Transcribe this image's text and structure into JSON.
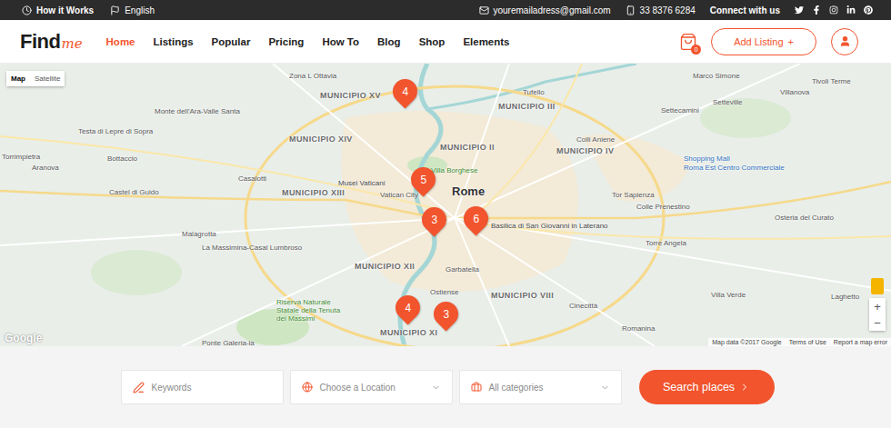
{
  "topbar": {
    "links": [
      {
        "label": "How it Works"
      },
      {
        "label": "English"
      }
    ],
    "email": "youremailadress@gmail.com",
    "phone": "33 8376 6284",
    "social_label": "Connect with us"
  },
  "header": {
    "logo": {
      "main": "Find",
      "accent": "me"
    },
    "nav": [
      {
        "label": "Home",
        "selected": true
      },
      {
        "label": "Listings",
        "selected": false
      },
      {
        "label": "Popular",
        "selected": false
      },
      {
        "label": "Pricing",
        "selected": false
      },
      {
        "label": "How To",
        "selected": false
      },
      {
        "label": "Blog",
        "selected": false
      },
      {
        "label": "Shop",
        "selected": false
      },
      {
        "label": "Elements",
        "selected": false
      }
    ],
    "cart_count": "0",
    "add_listing": "Add Listing",
    "add_icon": "+"
  },
  "map": {
    "types": [
      {
        "label": "Map",
        "selected": true
      },
      {
        "label": "Satellite",
        "selected": false
      }
    ],
    "labels": [
      {
        "text": "Zona L Ottavia",
        "kind": "place"
      },
      {
        "text": "MUNICIPIO XV",
        "kind": "district"
      },
      {
        "text": "Tufello",
        "kind": "place"
      },
      {
        "text": "MUNICIPIO III",
        "kind": "district"
      },
      {
        "text": "Marco Simone",
        "kind": "place"
      },
      {
        "text": "Tivoli Terme",
        "kind": "place"
      },
      {
        "text": "Villanova",
        "kind": "place"
      },
      {
        "text": "Setteville",
        "kind": "place"
      },
      {
        "text": "Settecamini",
        "kind": "place"
      },
      {
        "text": "Monte dell'Ara-Valle Santa",
        "kind": "place"
      },
      {
        "text": "Testa di Lepre di Sopra",
        "kind": "place"
      },
      {
        "text": "Torrimpietra",
        "kind": "place"
      },
      {
        "text": "Bottaccio",
        "kind": "place"
      },
      {
        "text": "Aranova",
        "kind": "place"
      },
      {
        "text": "MUNICIPIO XIV",
        "kind": "district"
      },
      {
        "text": "MUNICIPIO II",
        "kind": "district"
      },
      {
        "text": "MUNICIPIO IV",
        "kind": "district"
      },
      {
        "text": "Colli Aniene",
        "kind": "place"
      },
      {
        "text": "Villa Borghese",
        "kind": "park"
      },
      {
        "text": "Casalotti",
        "kind": "place"
      },
      {
        "text": "Musei Vaticani",
        "kind": "poi"
      },
      {
        "text": "Vatican City",
        "kind": "place"
      },
      {
        "text": "Rome",
        "kind": "city"
      },
      {
        "text": "MUNICIPIO XIII",
        "kind": "district"
      },
      {
        "text": "Castel di Guido",
        "kind": "place"
      },
      {
        "text": "Shopping Mall",
        "kind": "mall"
      },
      {
        "text": "Roma Est Centro Commerciale",
        "kind": "mall"
      },
      {
        "text": "Tor Sapienza",
        "kind": "place"
      },
      {
        "text": "Colle Prenestino",
        "kind": "place"
      },
      {
        "text": "Osteria del Curato",
        "kind": "place"
      },
      {
        "text": "Basilica di San Giovanni in Laterano",
        "kind": "poi"
      },
      {
        "text": "Malagrotta",
        "kind": "place"
      },
      {
        "text": "La Massimina-Casal Lumbroso",
        "kind": "place"
      },
      {
        "text": "Torre Angela",
        "kind": "place"
      },
      {
        "text": "MUNICIPIO XII",
        "kind": "district"
      },
      {
        "text": "Garbatella",
        "kind": "place"
      },
      {
        "text": "Ostiense",
        "kind": "place"
      },
      {
        "text": "MUNICIPIO VIII",
        "kind": "district"
      },
      {
        "text": "Riserva Naturale Statale della Tenuta dei Massimi",
        "kind": "park"
      },
      {
        "text": "Cinecittà",
        "kind": "place"
      },
      {
        "text": "Villa Verde",
        "kind": "place"
      },
      {
        "text": "Laghetto",
        "kind": "place"
      },
      {
        "text": "MUNICIPIO XI",
        "kind": "district"
      },
      {
        "text": "Romanina",
        "kind": "place"
      },
      {
        "text": "Ponte Galeria-la",
        "kind": "place"
      }
    ],
    "pins": [
      {
        "count": "4"
      },
      {
        "count": "5"
      },
      {
        "count": "3"
      },
      {
        "count": "6"
      },
      {
        "count": "4"
      },
      {
        "count": "3"
      }
    ],
    "zoom_in": "+",
    "zoom_out": "−",
    "google": "Google",
    "attribution": [
      "Map data ©2017 Google",
      "Terms of Use",
      "Report a map error"
    ]
  },
  "search": {
    "keywords_placeholder": "Keywords",
    "location_placeholder": "Choose a Location",
    "category_placeholder": "All categories",
    "button": "Search places"
  }
}
